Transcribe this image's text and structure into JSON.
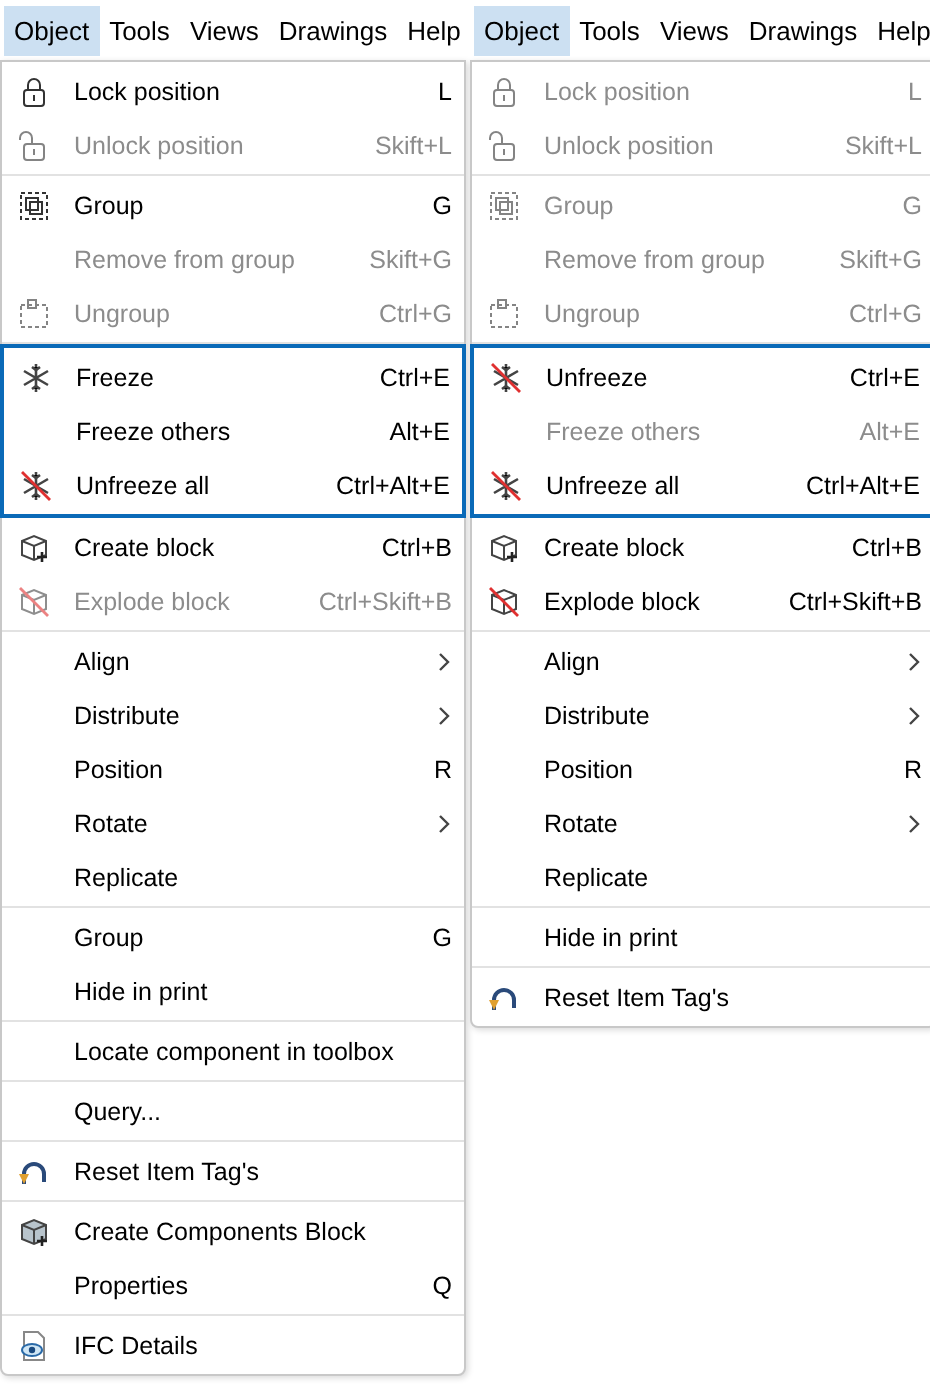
{
  "panels": [
    {
      "menubar": [
        {
          "label": "Object",
          "selected": true
        },
        {
          "label": "Tools",
          "selected": false
        },
        {
          "label": "Views",
          "selected": false
        },
        {
          "label": "Drawings",
          "selected": false
        },
        {
          "label": "Help",
          "selected": false
        }
      ],
      "sections": [
        {
          "highlighted": false,
          "items": [
            {
              "label": "Lock position",
              "shortcut": "L",
              "disabled": false,
              "kind": "lock"
            },
            {
              "label": "Unlock position",
              "shortcut": "Skift+L",
              "disabled": true,
              "kind": "unlock"
            }
          ]
        },
        {
          "highlighted": false,
          "items": [
            {
              "label": "Group",
              "shortcut": "G",
              "disabled": false,
              "kind": "group"
            },
            {
              "label": "Remove from group",
              "shortcut": "Skift+G",
              "disabled": true
            },
            {
              "label": "Ungroup",
              "shortcut": "Ctrl+G",
              "disabled": true,
              "kind": "ungroup"
            }
          ]
        },
        {
          "highlighted": true,
          "items": [
            {
              "label": "Freeze",
              "shortcut": "Ctrl+E",
              "disabled": false,
              "kind": "snow"
            },
            {
              "label": "Freeze others",
              "shortcut": "Alt+E",
              "disabled": false
            },
            {
              "label": "Unfreeze all",
              "shortcut": "Ctrl+Alt+E",
              "disabled": false,
              "kind": "snowx"
            }
          ]
        },
        {
          "highlighted": false,
          "items": [
            {
              "label": "Create block",
              "shortcut": "Ctrl+B",
              "disabled": false,
              "kind": "cubeplus"
            },
            {
              "label": "Explode block",
              "shortcut": "Ctrl+Skift+B",
              "disabled": true,
              "kind": "cubex"
            }
          ]
        },
        {
          "highlighted": false,
          "items": [
            {
              "label": "Align",
              "submenu": true,
              "disabled": false
            },
            {
              "label": "Distribute",
              "submenu": true,
              "disabled": false
            },
            {
              "label": "Position",
              "shortcut": "R",
              "disabled": false
            },
            {
              "label": "Rotate",
              "submenu": true,
              "disabled": false
            },
            {
              "label": "Replicate",
              "disabled": false
            }
          ]
        },
        {
          "highlighted": false,
          "items": [
            {
              "label": "Group",
              "shortcut": "G",
              "disabled": false
            },
            {
              "label": "Hide in print",
              "disabled": false
            }
          ]
        },
        {
          "highlighted": false,
          "items": [
            {
              "label": "Locate component in toolbox",
              "disabled": false
            }
          ]
        },
        {
          "highlighted": false,
          "items": [
            {
              "label": "Query...",
              "disabled": false
            }
          ]
        },
        {
          "highlighted": false,
          "items": [
            {
              "label": "Reset Item Tag's",
              "disabled": false,
              "kind": "reset"
            }
          ]
        },
        {
          "highlighted": false,
          "items": [
            {
              "label": "Create Components Block",
              "disabled": false,
              "kind": "cube"
            },
            {
              "label": "Properties",
              "shortcut": "Q",
              "disabled": false
            }
          ]
        },
        {
          "highlighted": false,
          "items": [
            {
              "label": "IFC Details",
              "disabled": false,
              "kind": "eyedoc"
            }
          ]
        }
      ]
    },
    {
      "menubar": [
        {
          "label": "Object",
          "selected": true
        },
        {
          "label": "Tools",
          "selected": false
        },
        {
          "label": "Views",
          "selected": false
        },
        {
          "label": "Drawings",
          "selected": false
        },
        {
          "label": "Help",
          "selected": false
        }
      ],
      "sections": [
        {
          "highlighted": false,
          "items": [
            {
              "label": "Lock position",
              "shortcut": "L",
              "disabled": true,
              "kind": "lock"
            },
            {
              "label": "Unlock position",
              "shortcut": "Skift+L",
              "disabled": true,
              "kind": "unlock"
            }
          ]
        },
        {
          "highlighted": false,
          "items": [
            {
              "label": "Group",
              "shortcut": "G",
              "disabled": true,
              "kind": "group"
            },
            {
              "label": "Remove from group",
              "shortcut": "Skift+G",
              "disabled": true
            },
            {
              "label": "Ungroup",
              "shortcut": "Ctrl+G",
              "disabled": true,
              "kind": "ungroup"
            }
          ]
        },
        {
          "highlighted": true,
          "items": [
            {
              "label": "Unfreeze",
              "shortcut": "Ctrl+E",
              "disabled": false,
              "kind": "snowx"
            },
            {
              "label": "Freeze others",
              "shortcut": "Alt+E",
              "disabled": true
            },
            {
              "label": "Unfreeze all",
              "shortcut": "Ctrl+Alt+E",
              "disabled": false,
              "kind": "snowx"
            }
          ]
        },
        {
          "highlighted": false,
          "items": [
            {
              "label": "Create block",
              "shortcut": "Ctrl+B",
              "disabled": false,
              "kind": "cubeplus"
            },
            {
              "label": "Explode block",
              "shortcut": "Ctrl+Skift+B",
              "disabled": false,
              "kind": "cubex"
            }
          ]
        },
        {
          "highlighted": false,
          "items": [
            {
              "label": "Align",
              "submenu": true,
              "disabled": false
            },
            {
              "label": "Distribute",
              "submenu": true,
              "disabled": false
            },
            {
              "label": "Position",
              "shortcut": "R",
              "disabled": false
            },
            {
              "label": "Rotate",
              "submenu": true,
              "disabled": false
            },
            {
              "label": "Replicate",
              "disabled": false
            }
          ]
        },
        {
          "highlighted": false,
          "items": [
            {
              "label": "Hide in print",
              "disabled": false
            }
          ]
        },
        {
          "highlighted": false,
          "items": [
            {
              "label": "Reset Item Tag's",
              "disabled": false,
              "kind": "reset"
            }
          ]
        }
      ]
    }
  ]
}
